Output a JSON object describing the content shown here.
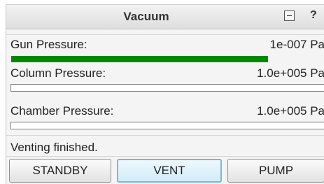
{
  "window": {
    "title": "Vacuum",
    "help_label": "?"
  },
  "gauges": [
    {
      "label": "Gun Pressure:",
      "value": "1e-007 Pa",
      "fill_fraction": 0.82,
      "fill_color": "#008a00"
    },
    {
      "label": "Column Pressure:",
      "value": "1.0e+005 Pa",
      "fill_fraction": 0.0,
      "fill_color": "#008a00"
    },
    {
      "label": "Chamber Pressure:",
      "value": "1.0e+005 Pa",
      "fill_fraction": 0.0,
      "fill_color": "#008a00"
    }
  ],
  "status": {
    "text": "Venting finished."
  },
  "buttons": [
    {
      "label": "STANDBY",
      "active": false
    },
    {
      "label": "VENT",
      "active": true
    },
    {
      "label": "PUMP",
      "active": false
    }
  ],
  "colors": {
    "active_border": "#79b8de",
    "progress_fill": "#008a00"
  }
}
